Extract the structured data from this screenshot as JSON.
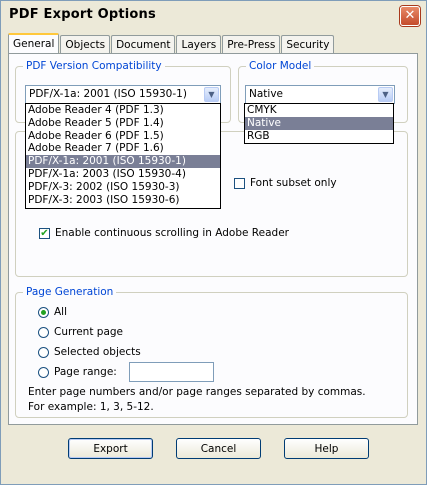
{
  "window": {
    "title": "PDF Export Options",
    "close_glyph": "✕"
  },
  "tabs": [
    "General",
    "Objects",
    "Document",
    "Layers",
    "Pre-Press",
    "Security"
  ],
  "pdf_version": {
    "group_title": "PDF Version Compatibility",
    "selected": "PDF/X-1a: 2001 (ISO 15930-1)",
    "options": [
      "Adobe Reader 4 (PDF 1.3)",
      "Adobe Reader 5 (PDF 1.4)",
      "Adobe Reader 6 (PDF 1.5)",
      "Adobe Reader 7 (PDF 1.6)",
      "PDF/X-1a: 2001 (ISO 15930-1)",
      "PDF/X-1a: 2003 (ISO 15930-4)",
      "PDF/X-3: 2002 (ISO 15930-3)",
      "PDF/X-3: 2003 (ISO 15930-6)"
    ]
  },
  "color_model": {
    "group_title": "Color Model",
    "selected": "Native",
    "options": [
      "CMYK",
      "Native",
      "RGB"
    ]
  },
  "options": {
    "font_subset_label": "Font subset only",
    "continuous_scroll_label": "Enable continuous scrolling in Adobe Reader"
  },
  "page_generation": {
    "group_title": "Page Generation",
    "radio_all": "All",
    "radio_current": "Current page",
    "radio_selected": "Selected objects",
    "radio_range": "Page range:",
    "range_value": "",
    "note_line1": "Enter page numbers and/or page ranges separated by commas.",
    "note_line2": "For example: 1, 3, 5-12."
  },
  "buttons": {
    "export": "Export",
    "cancel": "Cancel",
    "help": "Help"
  },
  "icons": {
    "dropdown_arrow": "▼",
    "check": "✔"
  },
  "colors": {
    "group_title": "#0046d5",
    "selection": "#7a7f96",
    "tab_highlight": "#ffc83c"
  }
}
